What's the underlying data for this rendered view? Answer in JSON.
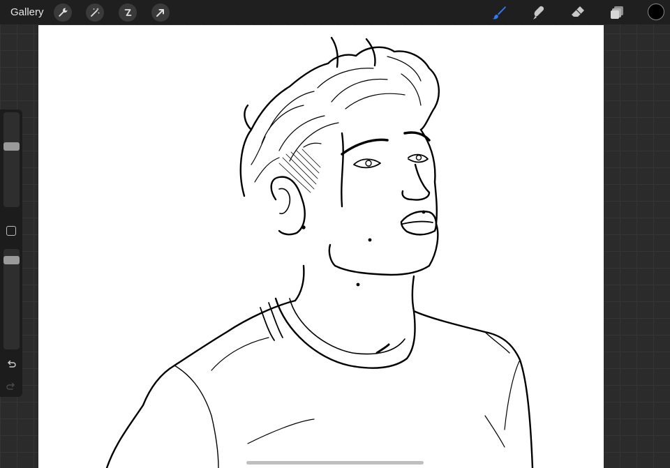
{
  "topbar": {
    "gallery_label": "Gallery",
    "left_tools": [
      "wrench-icon",
      "magic-wand-icon",
      "selection-icon",
      "transform-arrow-icon"
    ],
    "right_tools": [
      "brush-icon",
      "smudge-icon",
      "eraser-icon",
      "layers-icon"
    ],
    "active_tool": "brush-icon",
    "current_color": "#000000"
  },
  "sidebar": {
    "brush_size_level": 0.63,
    "opacity_level": 0.97,
    "buttons": [
      "modify-square-icon",
      "undo-icon",
      "redo-icon"
    ]
  },
  "colors": {
    "accent_blue": "#3478f6",
    "toolbar_bg": "#1f1f1f",
    "workspace_bg": "#2b2b2b",
    "canvas_bg": "#ffffff"
  }
}
